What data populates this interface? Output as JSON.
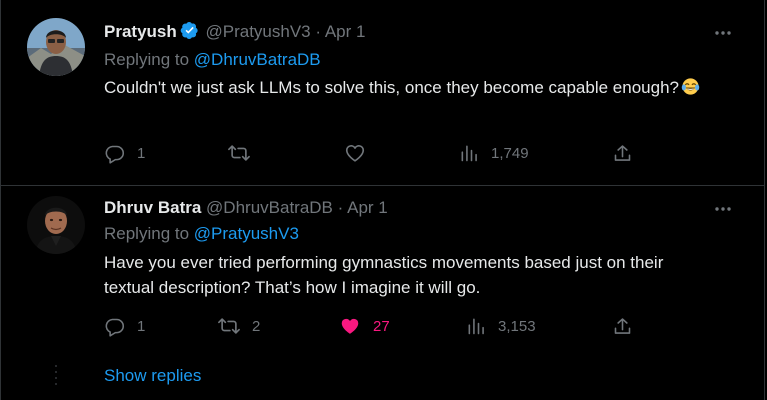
{
  "tweets": [
    {
      "name": "Pratyush",
      "verified": true,
      "handle": "@PratyushV3",
      "separator": "·",
      "date": "Apr 1",
      "replying_prefix": "Replying to",
      "replying_to": "@DhruvBatraDB",
      "text": "Couldn't we just ask LLMs to solve this, once they become capable enough?",
      "emoji": "face-with-tears-of-joy",
      "replies": "1",
      "retweets": "",
      "likes": "",
      "views": "1,749",
      "liked": false
    },
    {
      "name": "Dhruv Batra",
      "verified": false,
      "handle": "@DhruvBatraDB",
      "separator": "·",
      "date": "Apr 1",
      "replying_prefix": "Replying to",
      "replying_to": "@PratyushV3",
      "text": "Have you ever tried performing gymnastics movements based just on their textual description? That’s how I imagine it will go.",
      "replies": "1",
      "retweets": "2",
      "likes": "27",
      "views": "3,153",
      "liked": true
    }
  ],
  "show_replies": "Show replies",
  "colors": {
    "background": "#000000",
    "text": "#e7e9ea",
    "muted": "#71767b",
    "link": "#1d9bf0",
    "like": "#f91880",
    "border": "#2f3336"
  }
}
